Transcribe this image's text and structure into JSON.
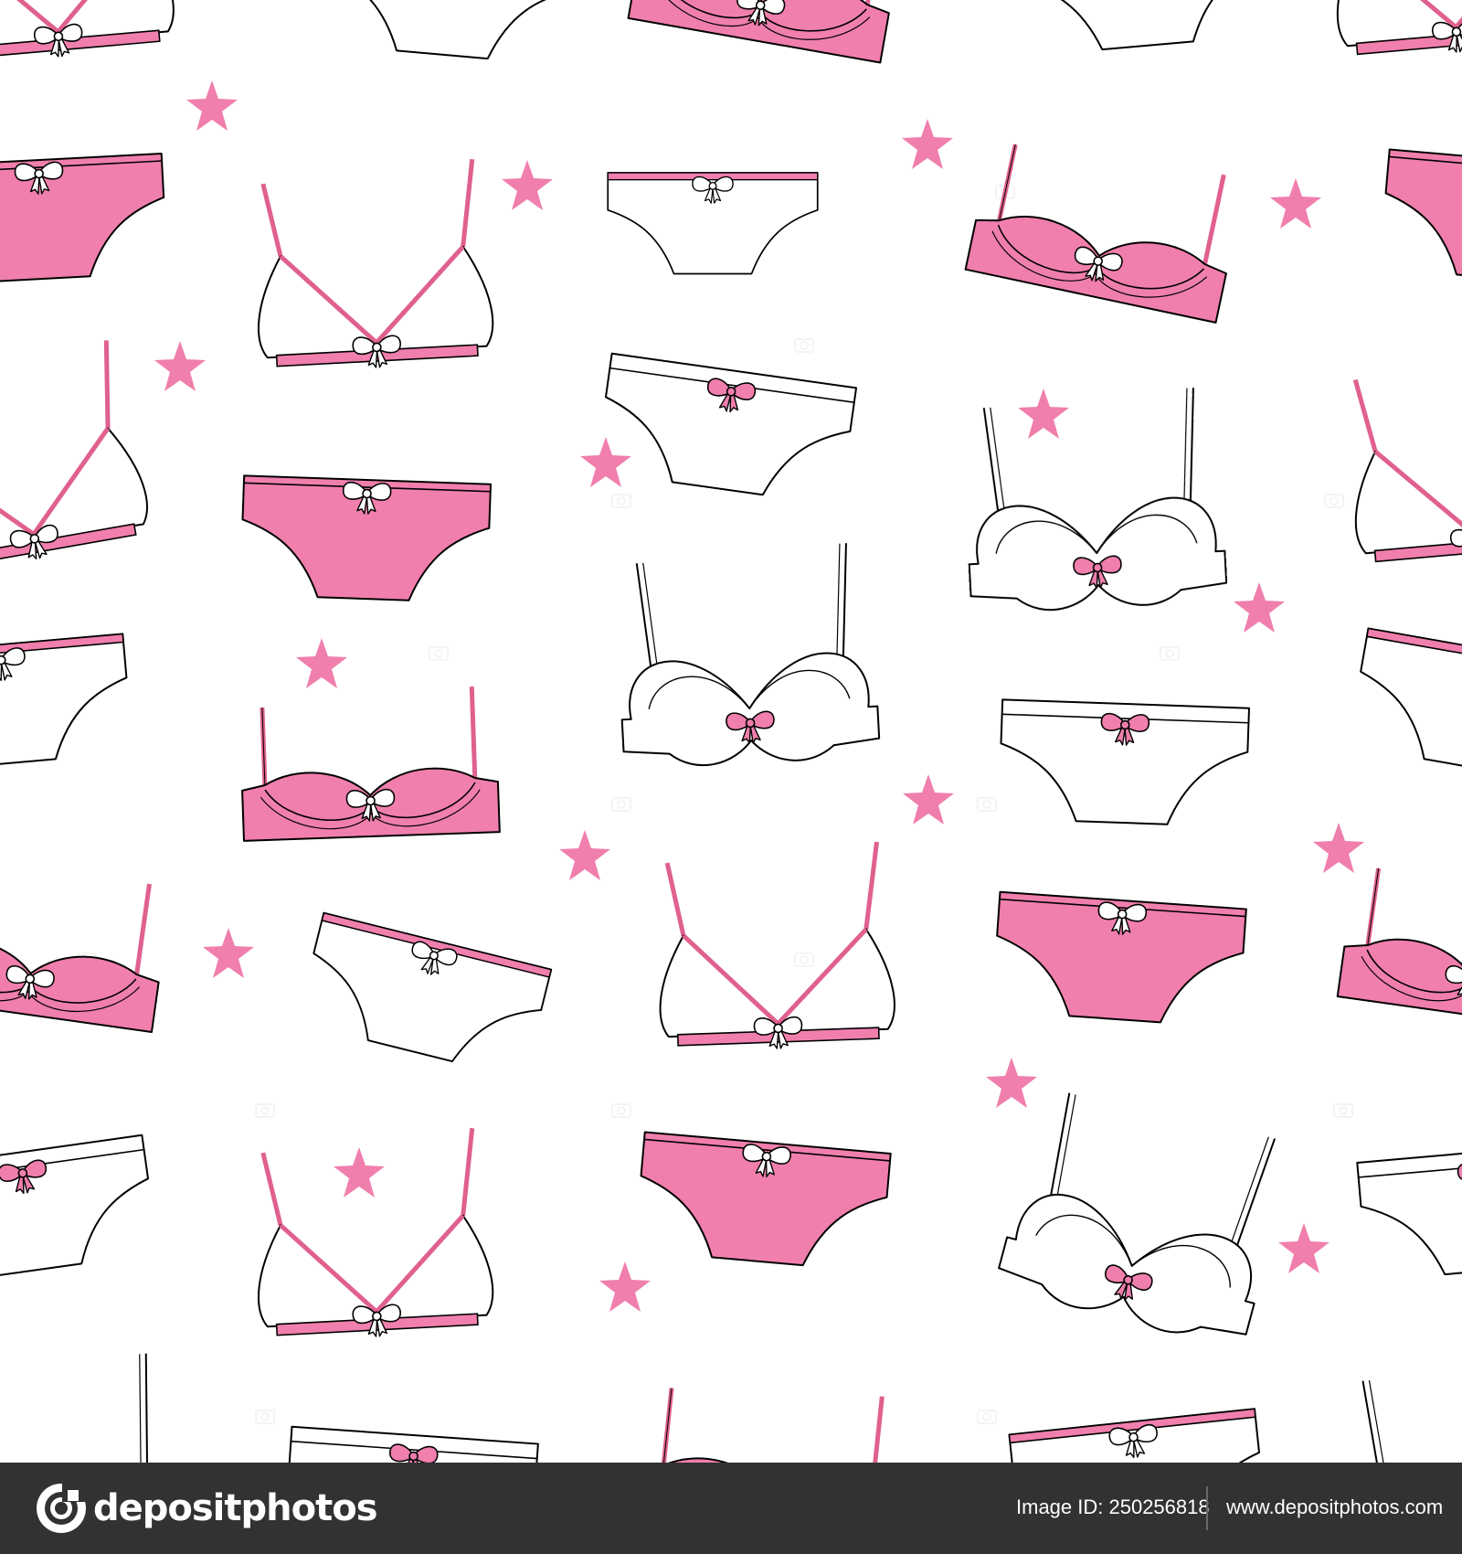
{
  "colors": {
    "background": "#ffffff",
    "pink": "#f07fad",
    "pink_dark": "#e0608f",
    "outline": "#000000",
    "star": "#f07fad",
    "footer_bg": "#323232",
    "footer_text": "#ffffff"
  },
  "pattern": {
    "icons": [
      "bra-icon",
      "panties-icon",
      "bow-icon",
      "star-icon"
    ]
  },
  "footer": {
    "brand_name": "depositphotos",
    "brand_icon": "depositphotos-logo-icon",
    "image_id": "Image ID: 250256818",
    "site_url": "www.depositphotos.com"
  }
}
